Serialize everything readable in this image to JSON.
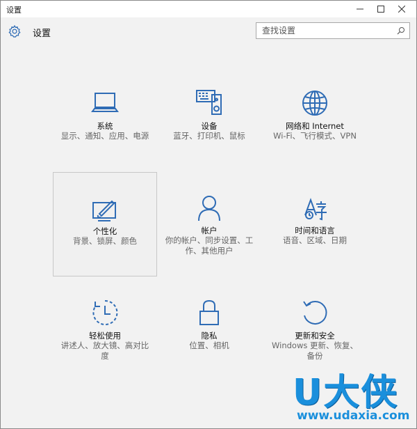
{
  "window": {
    "title": "设置",
    "minimize": "—",
    "maximize": "☐",
    "close": "✕"
  },
  "header": {
    "title": "设置",
    "search_placeholder": "查找设置"
  },
  "accent": "#2f6cb5",
  "tiles": [
    {
      "name": "系统",
      "desc": "显示、通知、应用、电源",
      "icon": "laptop-icon"
    },
    {
      "name": "设备",
      "desc": "蓝牙、打印机、鼠标",
      "icon": "devices-icon"
    },
    {
      "name": "网络和 Internet",
      "desc": "Wi-Fi、飞行模式、VPN",
      "icon": "globe-icon"
    },
    {
      "name": "个性化",
      "desc": "背景、锁屏、颜色",
      "icon": "personalization-icon"
    },
    {
      "name": "帐户",
      "desc": "你的帐户、同步设置、工作、其他用户",
      "icon": "person-icon"
    },
    {
      "name": "时间和语言",
      "desc": "语音、区域、日期",
      "icon": "time-language-icon"
    },
    {
      "name": "轻松使用",
      "desc": "讲述人、放大镜、高对比度",
      "icon": "ease-of-access-icon"
    },
    {
      "name": "隐私",
      "desc": "位置、相机",
      "icon": "lock-icon"
    },
    {
      "name": "更新和安全",
      "desc": "Windows 更新、恢复、备份",
      "icon": "update-icon"
    }
  ],
  "watermark": {
    "brand": "U大侠",
    "url": "www.udaxia.com"
  }
}
